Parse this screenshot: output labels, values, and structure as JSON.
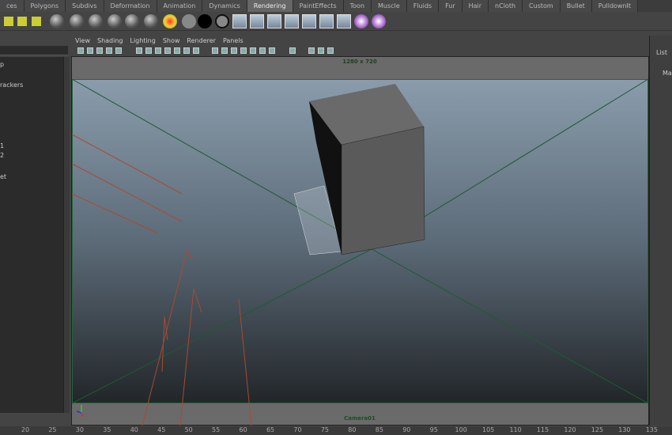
{
  "shelf_tabs": [
    "ces",
    "Polygons",
    "Subdivs",
    "Deformation",
    "Animation",
    "Dynamics",
    "Rendering",
    "PaintEffects",
    "Toon",
    "Muscle",
    "Fluids",
    "Fur",
    "Hair",
    "nCloth",
    "Custom",
    "Bullet",
    "PulldownIt"
  ],
  "active_tab": "Rendering",
  "panel_menu": [
    "View",
    "Shading",
    "Lighting",
    "Show",
    "Renderer",
    "Panels"
  ],
  "outliner_items": [
    "p",
    "rackers",
    "1",
    "2",
    "et"
  ],
  "viewport": {
    "resolution": "1280 x 720",
    "camera": "Camera01"
  },
  "right_panel": {
    "list_label": "List",
    "item": "Ma"
  },
  "timeline_ticks": [
    "20",
    "25",
    "30",
    "35",
    "40",
    "45",
    "50",
    "55",
    "60",
    "65",
    "70",
    "75",
    "80",
    "85",
    "90",
    "95",
    "100",
    "105",
    "110",
    "115",
    "120",
    "125",
    "130",
    "135"
  ]
}
